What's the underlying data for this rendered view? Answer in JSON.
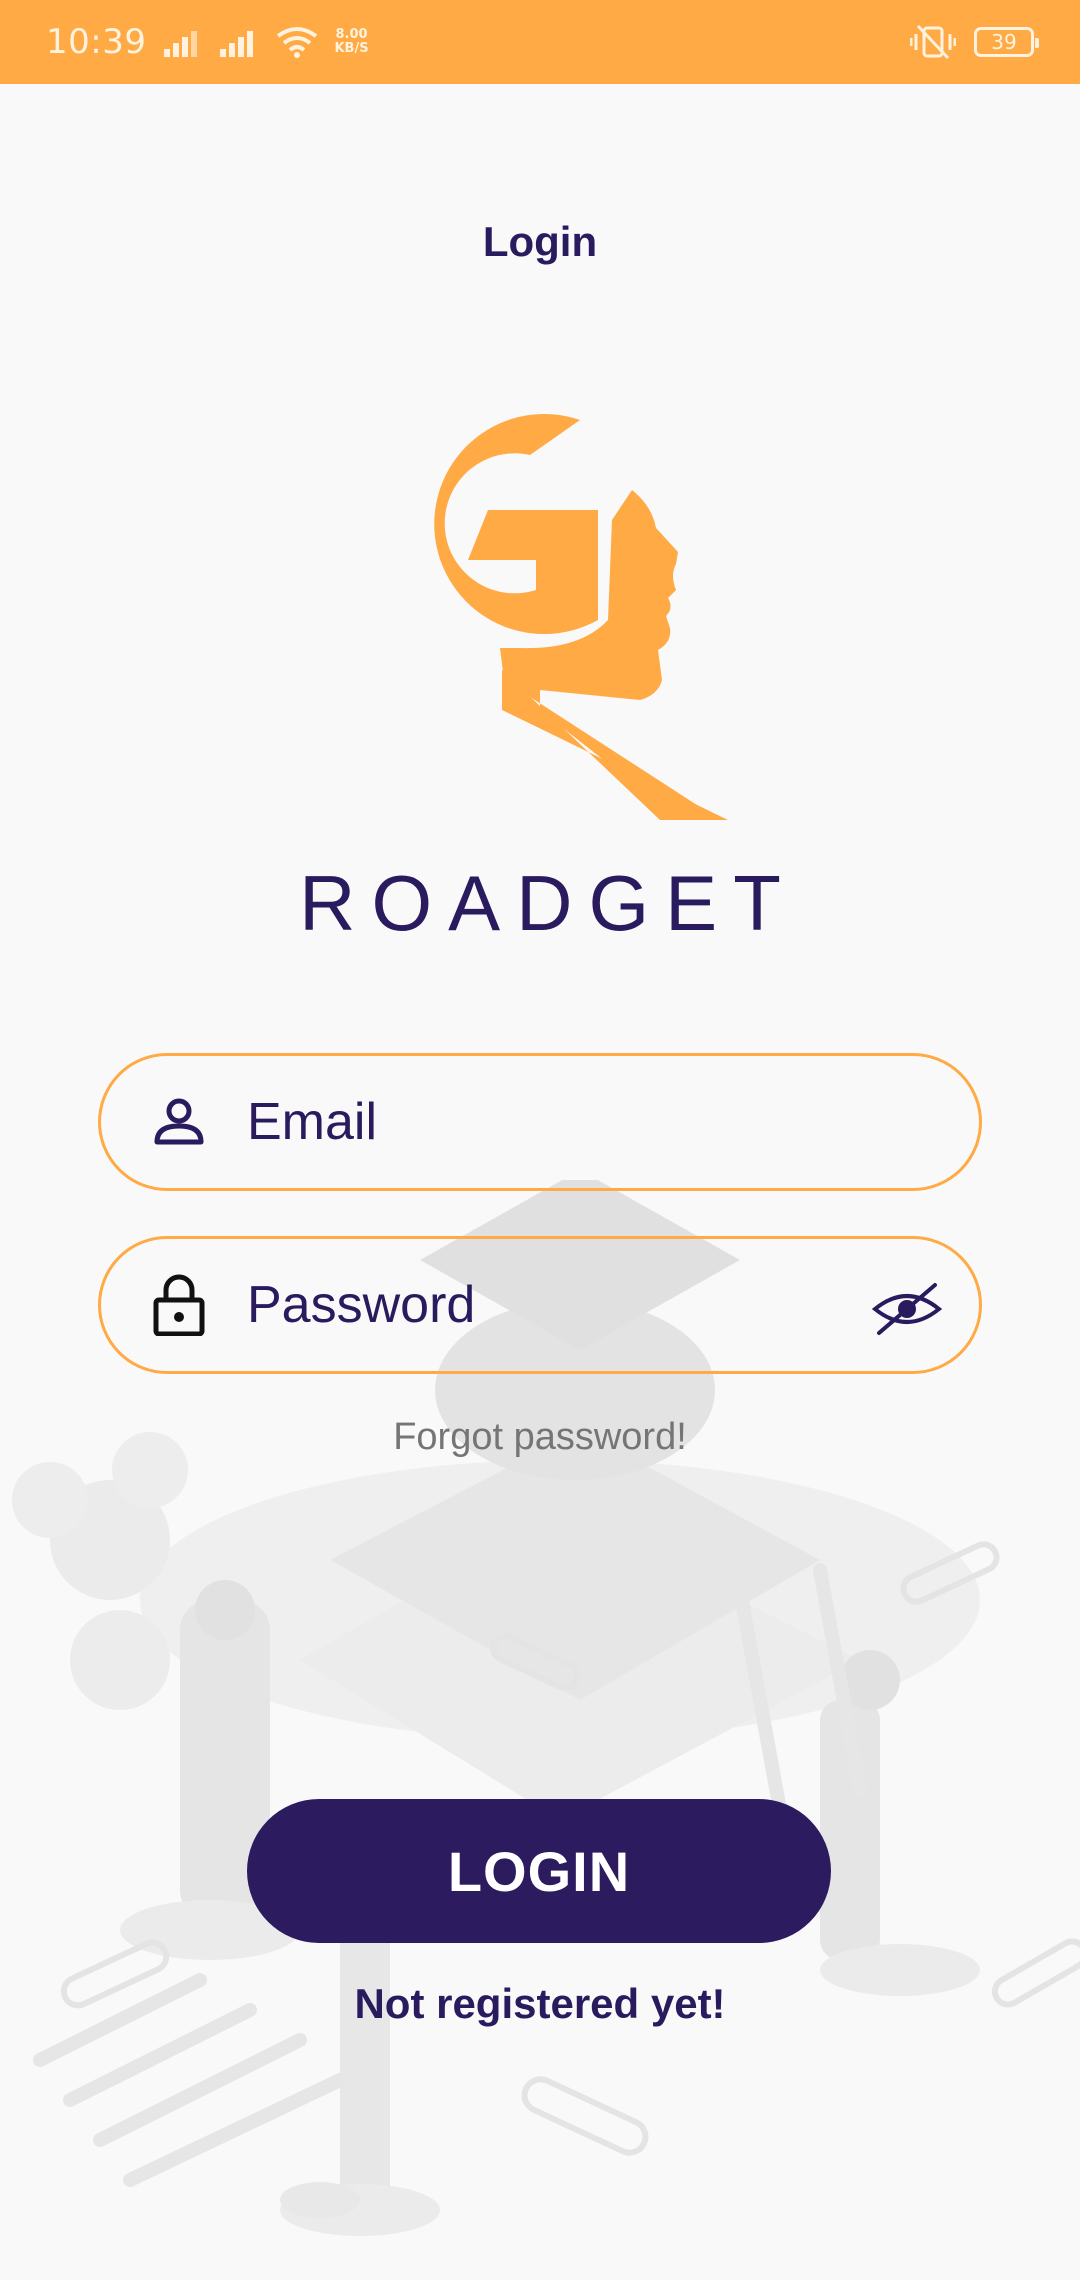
{
  "status_bar": {
    "time": "10:39",
    "net_speed_value": "8.00",
    "net_speed_unit": "KB/S",
    "battery_level": "39",
    "background_color": "#ffaa44"
  },
  "header": {
    "title": "Login"
  },
  "brand": {
    "name": "ROADGET",
    "logo_icon": "gr-head-logo-icon",
    "accent_color": "#ffaa44",
    "primary_color": "#2a1a5e"
  },
  "form": {
    "email": {
      "placeholder": "Email",
      "icon": "person-icon"
    },
    "password": {
      "placeholder": "Password",
      "icon": "lock-icon",
      "toggle_icon": "eye-off-icon"
    },
    "forgot_password": "Forgot password!",
    "login_button": "LOGIN",
    "register_link": "Not registered yet!"
  }
}
